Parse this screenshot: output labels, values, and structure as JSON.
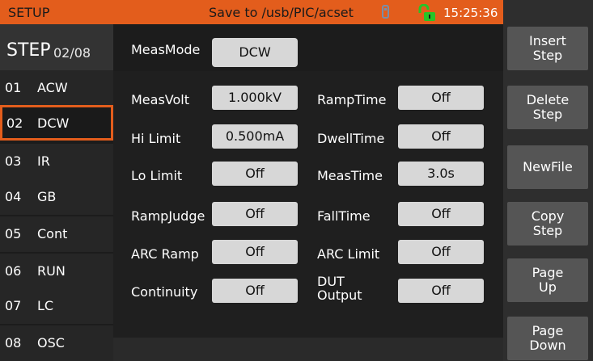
{
  "header": {
    "title": "SETUP",
    "save_path": "Save to /usb/PIC/acset",
    "time": "15:25:36",
    "usb_icon": "usb-drive-icon",
    "lock_icon": "unlocked-padlock-icon",
    "colors": {
      "accent": "#e35d1c",
      "lock": "#27c427"
    }
  },
  "step": {
    "label": "STEP",
    "count": "02/08"
  },
  "steps": [
    {
      "num": "01",
      "name": "ACW"
    },
    {
      "num": "02",
      "name": "DCW",
      "selected": true
    },
    {
      "num": "03",
      "name": "IR"
    },
    {
      "num": "04",
      "name": "GB"
    },
    {
      "num": "05",
      "name": "Cont"
    },
    {
      "num": "06",
      "name": "RUN"
    },
    {
      "num": "07",
      "name": "LC"
    },
    {
      "num": "08",
      "name": "OSC"
    }
  ],
  "meas_mode": {
    "label": "MeasMode",
    "value": "DCW"
  },
  "params_left": [
    {
      "label": "MeasVolt",
      "value": "1.000kV"
    },
    {
      "label": "Hi Limit",
      "value": "0.500mA"
    },
    {
      "label": "Lo Limit",
      "value": "Off"
    },
    {
      "label": "RampJudge",
      "value": "Off"
    },
    {
      "label": "ARC Ramp",
      "value": "Off"
    },
    {
      "label": "Continuity",
      "value": "Off"
    }
  ],
  "params_right": [
    {
      "label": "RampTime",
      "value": "Off"
    },
    {
      "label": "DwellTime",
      "value": "Off"
    },
    {
      "label": "MeasTime",
      "value": "3.0s"
    },
    {
      "label": "FallTime",
      "value": "Off"
    },
    {
      "label": "ARC Limit",
      "value": "Off"
    },
    {
      "label": "DUT\nOutput",
      "value": "Off"
    }
  ],
  "side_buttons": [
    {
      "label": "Insert\nStep"
    },
    {
      "label": "Delete\nStep"
    },
    {
      "label": "NewFile"
    },
    {
      "label": "Copy\nStep"
    },
    {
      "label": "Page\nUp"
    },
    {
      "label": "Page\nDown"
    }
  ]
}
